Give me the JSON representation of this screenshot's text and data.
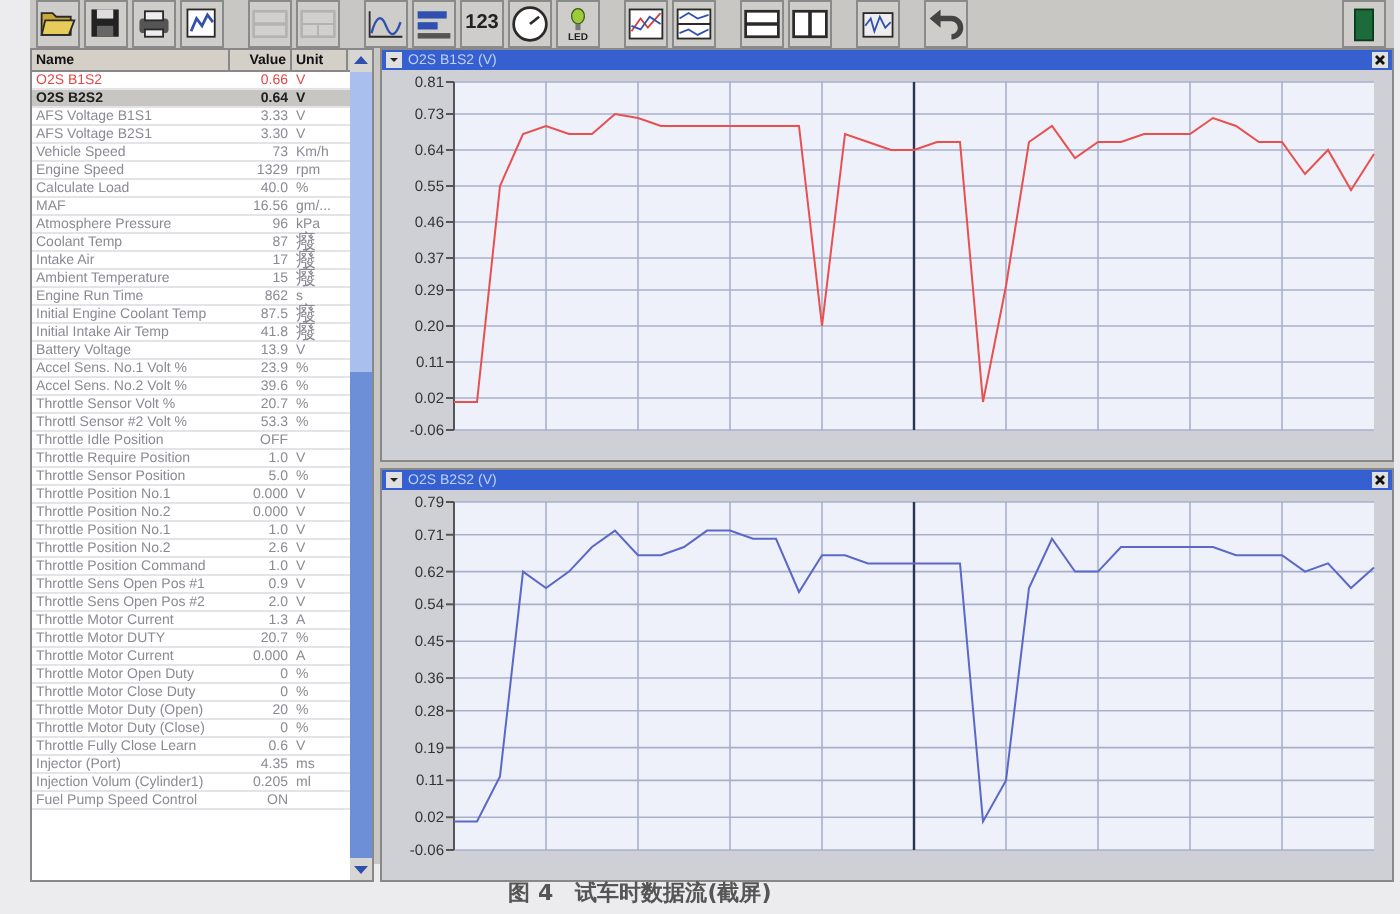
{
  "toolbar": {
    "groups": [
      [
        {
          "kind": "folder",
          "disabled": false
        },
        {
          "kind": "save",
          "disabled": false
        },
        {
          "kind": "printer",
          "disabled": false
        },
        {
          "kind": "chart",
          "disabled": false
        }
      ],
      [
        {
          "kind": "split-rows",
          "disabled": true
        },
        {
          "kind": "split-grid",
          "disabled": true
        }
      ],
      [
        {
          "kind": "line-graph",
          "disabled": false
        },
        {
          "kind": "bar-graph",
          "disabled": false
        },
        {
          "kind": "text",
          "label": "123",
          "disabled": false
        },
        {
          "kind": "gauge",
          "disabled": false
        },
        {
          "kind": "bulb",
          "label": "LED",
          "disabled": false
        }
      ],
      [
        {
          "kind": "multi-graph",
          "disabled": false
        },
        {
          "kind": "stacked-graph",
          "disabled": false
        }
      ],
      [
        {
          "kind": "split-rows",
          "disabled": false
        },
        {
          "kind": "split-columns",
          "disabled": false
        }
      ],
      [
        {
          "kind": "scope",
          "disabled": false
        }
      ],
      [
        {
          "kind": "undo",
          "disabled": false
        }
      ],
      [
        {
          "kind": "exit",
          "disabled": false
        }
      ]
    ]
  },
  "data_list": {
    "columns": [
      "Name",
      "Value",
      "Unit"
    ],
    "rows": [
      {
        "name": "O2S B1S2",
        "value": "0.66",
        "unit": "V",
        "selected": false,
        "color": "#e04848"
      },
      {
        "name": "O2S B2S2",
        "value": "0.64",
        "unit": "V",
        "selected": true,
        "color": "#202020"
      },
      {
        "name": "AFS Voltage B1S1",
        "value": "3.33",
        "unit": "V",
        "selected": false
      },
      {
        "name": "AFS Voltage B2S1",
        "value": "3.30",
        "unit": "V",
        "selected": false
      },
      {
        "name": "Vehicle Speed",
        "value": "73",
        "unit": "Km/h",
        "selected": false
      },
      {
        "name": "Engine Speed",
        "value": "1329",
        "unit": "rpm",
        "selected": false
      },
      {
        "name": "Calculate Load",
        "value": "40.0",
        "unit": "%",
        "selected": false
      },
      {
        "name": "MAF",
        "value": "16.56",
        "unit": "gm/...",
        "selected": false
      },
      {
        "name": "Atmosphere Pressure",
        "value": "96",
        "unit": "kPa",
        "selected": false
      },
      {
        "name": "Coolant Temp",
        "value": "87",
        "unit": "癈",
        "selected": false
      },
      {
        "name": "Intake Air",
        "value": "17",
        "unit": "癈",
        "selected": false
      },
      {
        "name": "Ambient Temperature",
        "value": "15",
        "unit": "癈",
        "selected": false
      },
      {
        "name": "Engine Run Time",
        "value": "862",
        "unit": "s",
        "selected": false
      },
      {
        "name": "Initial Engine Coolant Temp",
        "value": "87.5",
        "unit": "癈",
        "selected": false
      },
      {
        "name": "Initial Intake Air Temp",
        "value": "41.8",
        "unit": "癈",
        "selected": false
      },
      {
        "name": "Battery Voltage",
        "value": "13.9",
        "unit": "V",
        "selected": false
      },
      {
        "name": "Accel Sens. No.1 Volt %",
        "value": "23.9",
        "unit": "%",
        "selected": false
      },
      {
        "name": "Accel Sens. No.2 Volt %",
        "value": "39.6",
        "unit": "%",
        "selected": false
      },
      {
        "name": "Throttle Sensor Volt %",
        "value": "20.7",
        "unit": "%",
        "selected": false
      },
      {
        "name": "Throttl Sensor #2 Volt %",
        "value": "53.3",
        "unit": "%",
        "selected": false
      },
      {
        "name": "Throttle Idle Position",
        "value": "OFF",
        "selected": false
      },
      {
        "name": "Throttle Require Position",
        "value": "1.0",
        "unit": "V",
        "selected": false
      },
      {
        "name": "Throttle Sensor Position",
        "value": "5.0",
        "unit": "%",
        "selected": false
      },
      {
        "name": "Throttle Position No.1",
        "value": "0.000",
        "unit": "V",
        "selected": false
      },
      {
        "name": "Throttle Position No.2",
        "value": "0.000",
        "unit": "V",
        "selected": false
      },
      {
        "name": "Throttle Position No.1",
        "value": "1.0",
        "unit": "V",
        "selected": false
      },
      {
        "name": "Throttle Position No.2",
        "value": "2.6",
        "unit": "V",
        "selected": false
      },
      {
        "name": "Throttle Position Command",
        "value": "1.0",
        "unit": "V",
        "selected": false
      },
      {
        "name": "Throttle Sens Open Pos #1",
        "value": "0.9",
        "unit": "V",
        "selected": false
      },
      {
        "name": "Throttle Sens Open Pos #2",
        "value": "2.0",
        "unit": "V",
        "selected": false
      },
      {
        "name": "Throttle Motor Current",
        "value": "1.3",
        "unit": "A",
        "selected": false
      },
      {
        "name": "Throttle Motor DUTY",
        "value": "20.7",
        "unit": "%",
        "selected": false
      },
      {
        "name": "Throttle Motor Current",
        "value": "0.000",
        "unit": "A",
        "selected": false
      },
      {
        "name": "Throttle Motor Open Duty",
        "value": "0",
        "unit": "%",
        "selected": false
      },
      {
        "name": "Throttle Motor Close Duty",
        "value": "0",
        "unit": "%",
        "selected": false
      },
      {
        "name": "Throttle Motor Duty (Open)",
        "value": "20",
        "unit": "%",
        "selected": false
      },
      {
        "name": "Throttle Motor Duty (Close)",
        "value": "0",
        "unit": "%",
        "selected": false
      },
      {
        "name": "Throttle Fully Close Learn",
        "value": "0.6",
        "unit": "V",
        "selected": false
      },
      {
        "name": "Injector (Port)",
        "value": "4.35",
        "unit": "ms",
        "selected": false
      },
      {
        "name": "Injection Volum (Cylinder1)",
        "value": "0.205",
        "unit": "ml",
        "selected": false
      },
      {
        "name": "Fuel Pump Speed Control",
        "value": "ON",
        "selected": false
      }
    ]
  },
  "graphs": [
    {
      "chart_data": {
        "type": "line",
        "ylabel": "(V)",
        "grid": true,
        "ylim": [
          -0.06,
          0.81
        ],
        "yticks": [
          -0.06,
          0.02,
          0.11,
          {
            "value": 0.2,
            "label": "0.20"
          },
          0.29,
          0.37,
          0.46,
          0.55,
          0.64,
          0.73,
          0.81
        ],
        "series": [
          {
            "name": "O2S B1S2",
            "color": "#e85050",
            "values": [
              0.01,
              0.01,
              0.55,
              0.68,
              0.7,
              0.68,
              0.68,
              0.73,
              0.72,
              0.7,
              0.7,
              0.7,
              0.7,
              0.7,
              0.7,
              0.7,
              0.2,
              0.68,
              0.66,
              0.64,
              0.64,
              0.66,
              0.66,
              0.01,
              0.3,
              0.66,
              0.7,
              0.62,
              0.66,
              0.66,
              0.68,
              0.68,
              0.68,
              0.72,
              0.7,
              0.66,
              0.66,
              0.58,
              0.64,
              0.54,
              0.63
            ]
          }
        ]
      }
    },
    {
      "chart_data": {
        "type": "line",
        "ylabel": "(V)",
        "grid": true,
        "ylim": [
          -0.06,
          0.79
        ],
        "yticks": [
          -0.06,
          0.02,
          0.11,
          0.19,
          0.28,
          0.36,
          0.45,
          0.54,
          0.62,
          0.71,
          0.79
        ],
        "series": [
          {
            "name": "O2S B2S2",
            "color": "#5a68c8",
            "values": [
              0.01,
              0.01,
              0.12,
              0.62,
              0.58,
              0.62,
              0.68,
              0.72,
              0.66,
              0.66,
              0.68,
              0.72,
              0.72,
              0.7,
              0.7,
              0.57,
              0.66,
              0.66,
              0.64,
              0.64,
              0.64,
              0.64,
              0.64,
              0.01,
              0.11,
              0.58,
              0.7,
              0.62,
              0.62,
              0.68,
              0.68,
              0.68,
              0.68,
              0.68,
              0.66,
              0.66,
              0.66,
              0.62,
              0.64,
              0.58,
              0.63
            ]
          }
        ]
      }
    }
  ],
  "caption": "图 4　试车时数据流(截屏)"
}
